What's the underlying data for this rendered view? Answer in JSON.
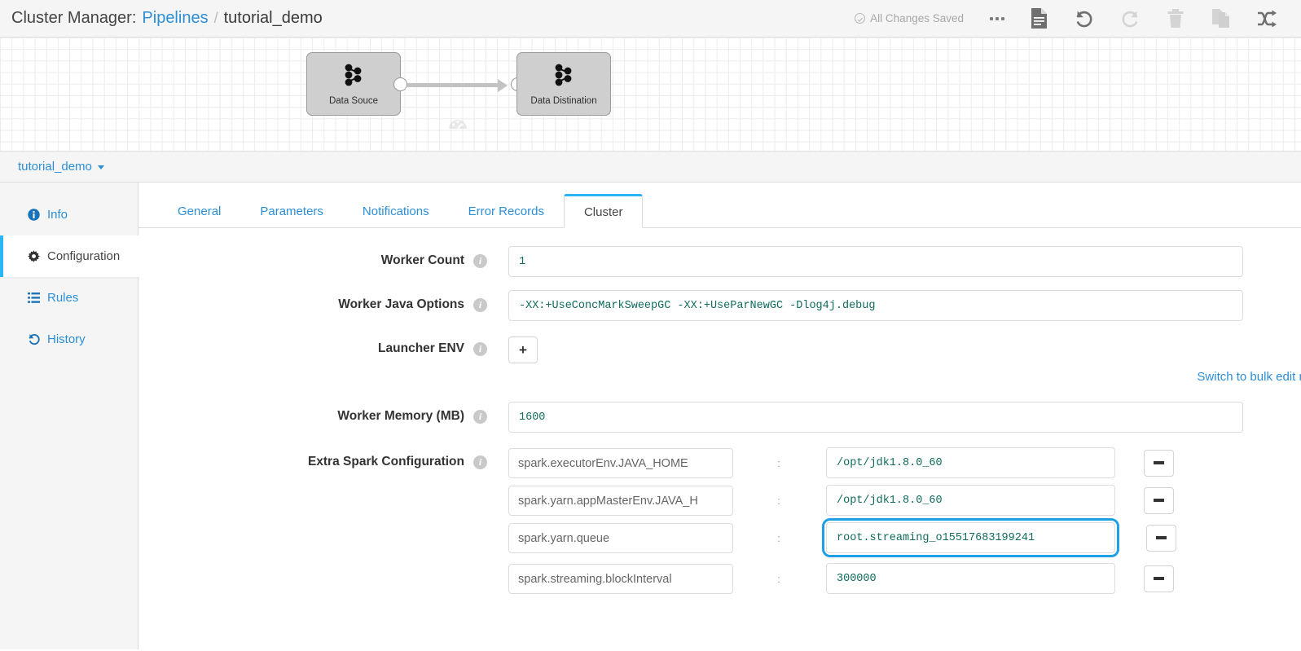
{
  "topbar": {
    "prefix": "Cluster Manager:",
    "breadcrumb_link": "Pipelines",
    "separator": "/",
    "current": "tutorial_demo",
    "saved_status": "All Changes Saved",
    "icons": [
      "more-icon",
      "document-icon",
      "undo-icon",
      "redo-icon",
      "trash-icon",
      "duplicate-icon",
      "shuffle-icon"
    ]
  },
  "canvas": {
    "nodes": [
      {
        "label": "Data Souce",
        "icon": "kafka-icon"
      },
      {
        "label": "Data Distination",
        "icon": "kafka-icon"
      }
    ],
    "edge_badge": "gauge-icon"
  },
  "selector": {
    "pipeline_name": "tutorial_demo"
  },
  "sidebar": {
    "items": [
      {
        "label": "Info",
        "icon": "info-icon",
        "active": false
      },
      {
        "label": "Configuration",
        "icon": "gear-icon",
        "active": true
      },
      {
        "label": "Rules",
        "icon": "list-icon",
        "active": false
      },
      {
        "label": "History",
        "icon": "history-icon",
        "active": false
      }
    ]
  },
  "tabs": [
    {
      "label": "General",
      "active": false
    },
    {
      "label": "Parameters",
      "active": false
    },
    {
      "label": "Notifications",
      "active": false
    },
    {
      "label": "Error Records",
      "active": false
    },
    {
      "label": "Cluster",
      "active": true
    }
  ],
  "form": {
    "worker_count": {
      "label": "Worker Count",
      "value": "1"
    },
    "worker_java_options": {
      "label": "Worker Java Options",
      "value": "-XX:+UseConcMarkSweepGC -XX:+UseParNewGC -Dlog4j.debug"
    },
    "launcher_env": {
      "label": "Launcher ENV",
      "add_label": "+"
    },
    "bulk_edit_link": "Switch to bulk edit mode",
    "worker_memory": {
      "label": "Worker Memory (MB)",
      "value": "1600"
    },
    "extra_spark": {
      "label": "Extra Spark Configuration",
      "separator": ":",
      "remove_label": "−",
      "rows": [
        {
          "key": "spark.executorEnv.JAVA_HOME",
          "value": "/opt/jdk1.8.0_60",
          "highlighted": false
        },
        {
          "key": "spark.yarn.appMasterEnv.JAVA_H",
          "value": "/opt/jdk1.8.0_60",
          "highlighted": false
        },
        {
          "key": "spark.yarn.queue",
          "value": "root.streaming_o15517683199241",
          "highlighted": true
        },
        {
          "key": "spark.streaming.blockInterval",
          "value": "300000",
          "highlighted": false
        }
      ]
    }
  },
  "colors": {
    "accent": "#2c8fd6",
    "active_tab_border": "#29b6f6",
    "highlight": "#1f9fe8",
    "input_text": "#0f6b5c"
  }
}
